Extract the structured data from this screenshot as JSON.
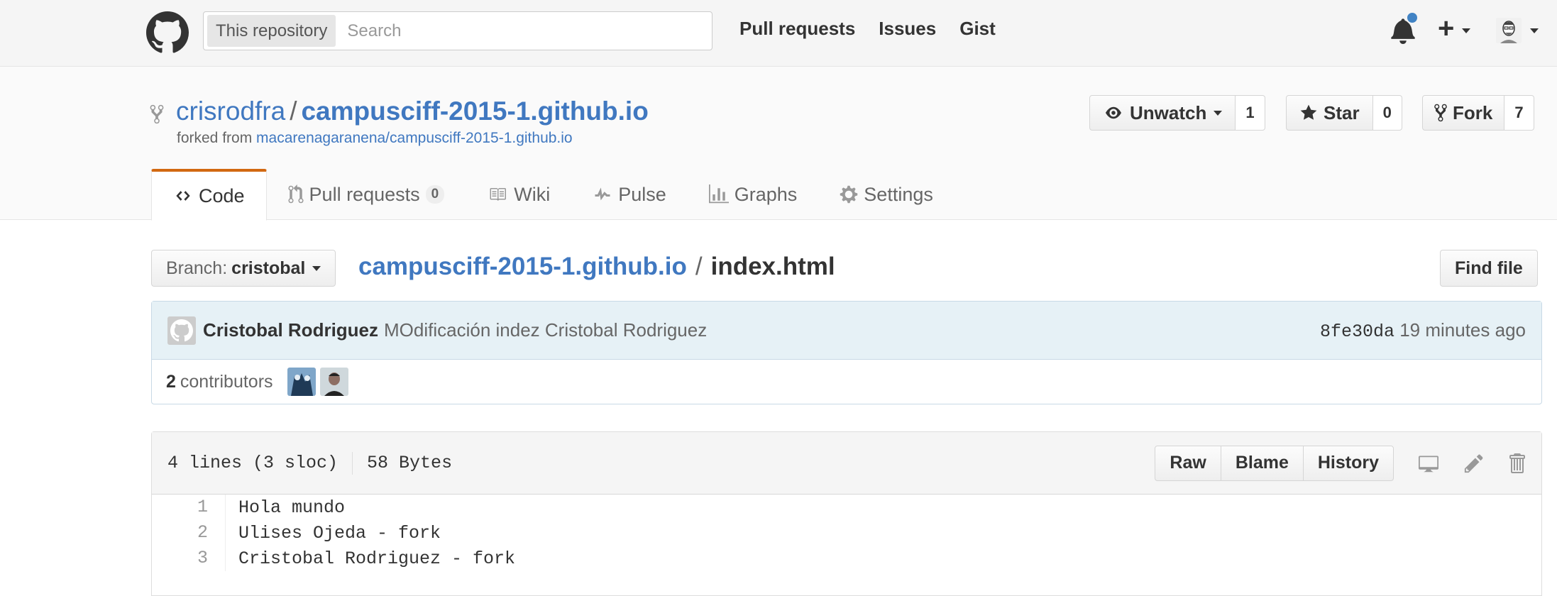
{
  "header": {
    "search_scope": "This repository",
    "search_placeholder": "Search",
    "nav": [
      "Pull requests",
      "Issues",
      "Gist"
    ]
  },
  "repo": {
    "owner": "crisrodfra",
    "separator": "/",
    "name": "campusciff-2015-1.github.io",
    "forked_from_label": "forked from",
    "forked_from_link": "macarenagaranena/campusciff-2015-1.github.io",
    "actions": {
      "unwatch_label": "Unwatch",
      "unwatch_count": "1",
      "star_label": "Star",
      "star_count": "0",
      "fork_label": "Fork",
      "fork_count": "7"
    }
  },
  "tabs": {
    "code": "Code",
    "pull_requests": "Pull requests",
    "pull_requests_count": "0",
    "wiki": "Wiki",
    "pulse": "Pulse",
    "graphs": "Graphs",
    "settings": "Settings"
  },
  "file_nav": {
    "branch_label": "Branch:",
    "branch_name": "cristobal",
    "breadcrumb_repo": "campusciff-2015-1.github.io",
    "breadcrumb_sep": "/",
    "breadcrumb_file": "index.html",
    "find_file": "Find file"
  },
  "commit": {
    "author": "Cristobal Rodriguez",
    "message": "MOdificación indez Cristobal Rodriguez",
    "sha": "8fe30da",
    "time": "19 minutes ago",
    "contributors_count": "2",
    "contributors_label": "contributors"
  },
  "file": {
    "info_lines": "4 lines (3 sloc)",
    "info_size": "58 Bytes",
    "buttons": {
      "raw": "Raw",
      "blame": "Blame",
      "history": "History"
    },
    "lines": [
      {
        "num": "1",
        "code": "Hola mundo"
      },
      {
        "num": "2",
        "code": "Ulises Ojeda - fork"
      },
      {
        "num": "3",
        "code": "Cristobal Rodriguez - fork"
      }
    ]
  },
  "colors": {
    "link": "#4078c0",
    "tab_accent": "#d26911",
    "notification": "#4183c4",
    "commit_bg": "#e6f1f6"
  }
}
